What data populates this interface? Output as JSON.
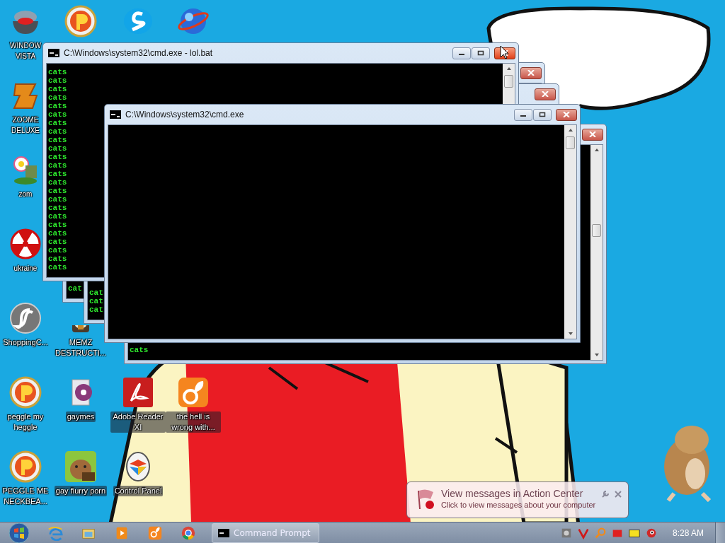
{
  "desktop_icons": [
    {
      "label": "WINDOW VISTA"
    },
    {
      "label": "ZOOME DELUXE"
    },
    {
      "label": "zom"
    },
    {
      "label": "ukraine"
    },
    {
      "label": "ShoppingC..."
    },
    {
      "label": "peggle my heggle"
    },
    {
      "label": "PEGGLE ME NECKBEA..."
    },
    {
      "label": "MEMZ DESTRUCTI..."
    },
    {
      "label": "gaymes"
    },
    {
      "label": "gay fiurry porn"
    },
    {
      "label": "Adobe Reader XI"
    },
    {
      "label": "Control Panel"
    },
    {
      "label": "the hell is wrong with..."
    }
  ],
  "windows": [
    {
      "title": "C:\\Windows\\system32\\cmd.exe",
      "close_highlighted": false
    },
    {
      "title": "C:\\Windows\\system32\\cmd.exe - lol.bat",
      "lines": [
        "cats",
        "cats",
        "cats",
        "cats",
        "cats",
        "cats",
        "cats",
        "cats",
        "cats",
        "cats",
        "cats",
        "cats",
        "cats",
        "cats",
        "cats",
        "cats",
        "cats",
        "cats",
        "cats",
        "cats",
        "cats",
        "cats",
        "cats",
        "cats"
      ],
      "close_highlighted": true
    },
    {
      "lines": [
        "cats"
      ],
      "close_highlighted": false
    },
    {
      "lines": [
        "cat",
        "cat",
        "cat"
      ],
      "close_highlighted": false
    },
    {
      "lines": [
        "cat"
      ],
      "close_highlighted": false
    }
  ],
  "notification": {
    "title": "View messages in Action Center",
    "text": "Click to view messages about your computer"
  },
  "taskbar": {
    "task": {
      "label": "Command Prompt",
      "selected": false
    },
    "clock": "8:28 AM"
  }
}
